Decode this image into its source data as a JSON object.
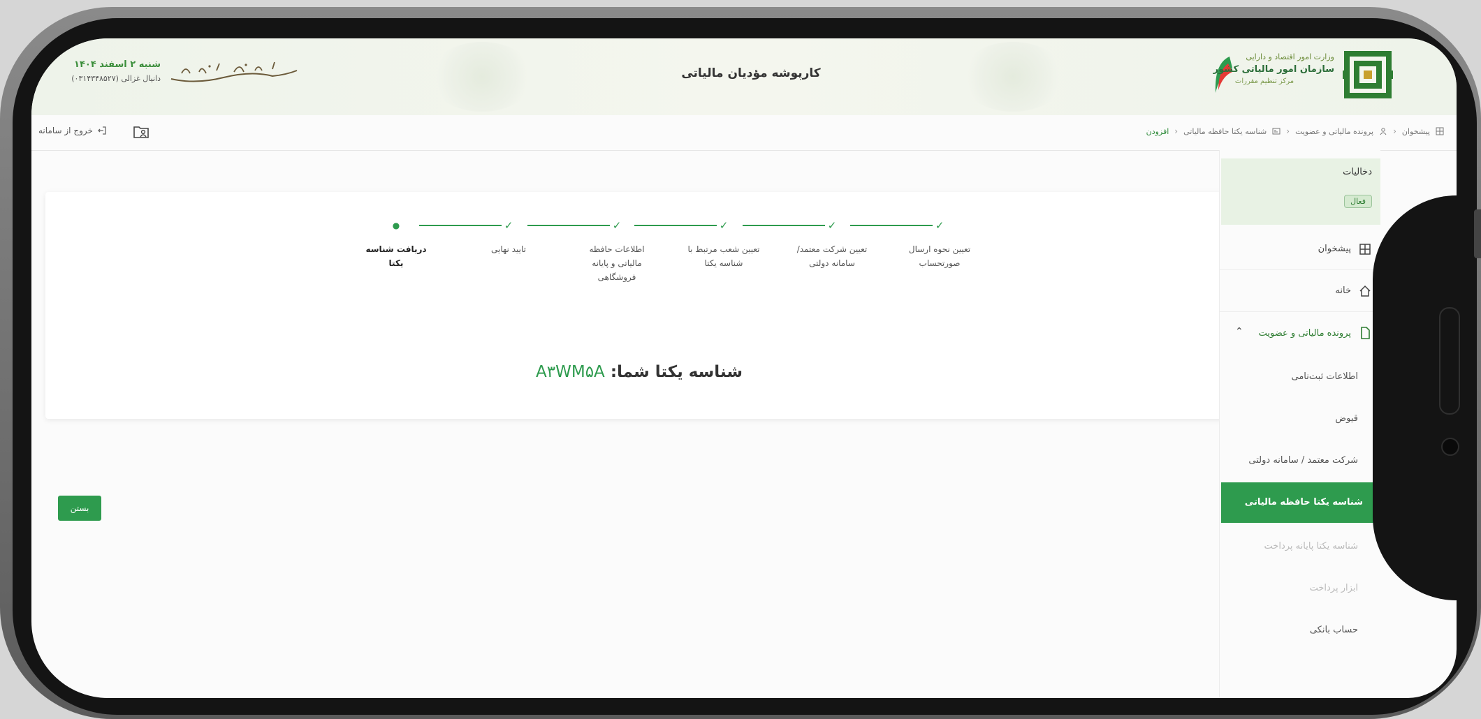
{
  "header": {
    "title": "کارپوشه مؤدیان مالیاتی",
    "org_line1": "وزارت امور اقتصاد و دارایی",
    "org_line2": "سازمان امور مالیاتی کشور",
    "org_line3": "مرکز تنظیم مقررات",
    "date_line1": "شنبه ۲ اسفند ۱۴۰۴",
    "date_line2": "دانیال غزالی (۰۳۱۴۳۴۸۵۲۷)",
    "calligraphy": "سپاه گذاری تکمیلی مالیاتی"
  },
  "toolbar": {
    "exit_label": "خروج از سامانه",
    "breadcrumb": [
      "پیشخوان",
      "پرونده مالیاتی و عضویت",
      "شناسه یکتا حافظه مالیاتی",
      "افزودن"
    ]
  },
  "stepper": {
    "steps": [
      {
        "label": "تعیین نحوه ارسال صورتحساب",
        "status": "done"
      },
      {
        "label": "تعیین شرکت معتمد/سامانه دولتی",
        "status": "done"
      },
      {
        "label": "تعیین شعب مرتبط با شناسه یکتا",
        "status": "done"
      },
      {
        "label": "اطلاعات حافظه مالیاتی و پایانه فروشگاهی",
        "status": "done"
      },
      {
        "label": "تایید نهایی",
        "status": "done"
      },
      {
        "label": "دریافت شناسه یکتا",
        "status": "current"
      }
    ]
  },
  "result": {
    "label": "شناسه یکتا شما:",
    "code": "A۳WM۵A"
  },
  "buttons": {
    "close_label": "بستن"
  },
  "sidebar": {
    "settings_title": "دخالیات",
    "settings_badge": "فعال",
    "items": [
      {
        "label": "پیشخوان",
        "icon": "dashboard-icon"
      },
      {
        "label": "خانه",
        "icon": "home-icon"
      },
      {
        "label": "پرونده مالیاتی و عضویت",
        "icon": "document-icon"
      }
    ],
    "sub_items": [
      {
        "label": "اطلاعات ثبت‌نامی",
        "state": "normal"
      },
      {
        "label": "قیوض",
        "state": "normal"
      },
      {
        "label": "شرکت معتمد / سامانه دولتی",
        "state": "normal"
      },
      {
        "label": "شناسه یکتا حافظه مالیاتی",
        "state": "selected"
      },
      {
        "label": "شناسه یکتا پایانه پرداخت",
        "state": "disabled"
      },
      {
        "label": "ابزار پرداخت",
        "state": "disabled"
      },
      {
        "label": "حساب بانکی",
        "state": "normal"
      }
    ]
  },
  "colors": {
    "accent": "#2e9b4e",
    "header_bg": "#eef3ea",
    "settings_bg": "#e8f2e4"
  }
}
